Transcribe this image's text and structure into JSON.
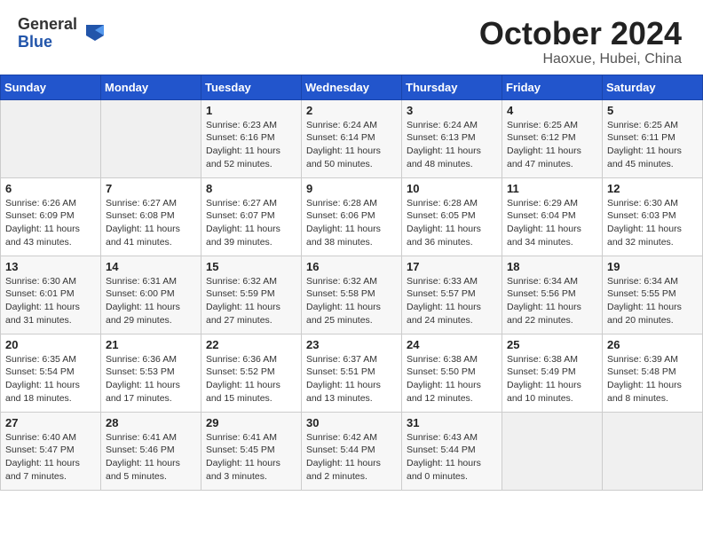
{
  "header": {
    "logo_general": "General",
    "logo_blue": "Blue",
    "month_title": "October 2024",
    "location": "Haoxue, Hubei, China"
  },
  "days_of_week": [
    "Sunday",
    "Monday",
    "Tuesday",
    "Wednesday",
    "Thursday",
    "Friday",
    "Saturday"
  ],
  "weeks": [
    [
      {
        "day": "",
        "info": ""
      },
      {
        "day": "",
        "info": ""
      },
      {
        "day": "1",
        "info": "Sunrise: 6:23 AM\nSunset: 6:16 PM\nDaylight: 11 hours and 52 minutes."
      },
      {
        "day": "2",
        "info": "Sunrise: 6:24 AM\nSunset: 6:14 PM\nDaylight: 11 hours and 50 minutes."
      },
      {
        "day": "3",
        "info": "Sunrise: 6:24 AM\nSunset: 6:13 PM\nDaylight: 11 hours and 48 minutes."
      },
      {
        "day": "4",
        "info": "Sunrise: 6:25 AM\nSunset: 6:12 PM\nDaylight: 11 hours and 47 minutes."
      },
      {
        "day": "5",
        "info": "Sunrise: 6:25 AM\nSunset: 6:11 PM\nDaylight: 11 hours and 45 minutes."
      }
    ],
    [
      {
        "day": "6",
        "info": "Sunrise: 6:26 AM\nSunset: 6:09 PM\nDaylight: 11 hours and 43 minutes."
      },
      {
        "day": "7",
        "info": "Sunrise: 6:27 AM\nSunset: 6:08 PM\nDaylight: 11 hours and 41 minutes."
      },
      {
        "day": "8",
        "info": "Sunrise: 6:27 AM\nSunset: 6:07 PM\nDaylight: 11 hours and 39 minutes."
      },
      {
        "day": "9",
        "info": "Sunrise: 6:28 AM\nSunset: 6:06 PM\nDaylight: 11 hours and 38 minutes."
      },
      {
        "day": "10",
        "info": "Sunrise: 6:28 AM\nSunset: 6:05 PM\nDaylight: 11 hours and 36 minutes."
      },
      {
        "day": "11",
        "info": "Sunrise: 6:29 AM\nSunset: 6:04 PM\nDaylight: 11 hours and 34 minutes."
      },
      {
        "day": "12",
        "info": "Sunrise: 6:30 AM\nSunset: 6:03 PM\nDaylight: 11 hours and 32 minutes."
      }
    ],
    [
      {
        "day": "13",
        "info": "Sunrise: 6:30 AM\nSunset: 6:01 PM\nDaylight: 11 hours and 31 minutes."
      },
      {
        "day": "14",
        "info": "Sunrise: 6:31 AM\nSunset: 6:00 PM\nDaylight: 11 hours and 29 minutes."
      },
      {
        "day": "15",
        "info": "Sunrise: 6:32 AM\nSunset: 5:59 PM\nDaylight: 11 hours and 27 minutes."
      },
      {
        "day": "16",
        "info": "Sunrise: 6:32 AM\nSunset: 5:58 PM\nDaylight: 11 hours and 25 minutes."
      },
      {
        "day": "17",
        "info": "Sunrise: 6:33 AM\nSunset: 5:57 PM\nDaylight: 11 hours and 24 minutes."
      },
      {
        "day": "18",
        "info": "Sunrise: 6:34 AM\nSunset: 5:56 PM\nDaylight: 11 hours and 22 minutes."
      },
      {
        "day": "19",
        "info": "Sunrise: 6:34 AM\nSunset: 5:55 PM\nDaylight: 11 hours and 20 minutes."
      }
    ],
    [
      {
        "day": "20",
        "info": "Sunrise: 6:35 AM\nSunset: 5:54 PM\nDaylight: 11 hours and 18 minutes."
      },
      {
        "day": "21",
        "info": "Sunrise: 6:36 AM\nSunset: 5:53 PM\nDaylight: 11 hours and 17 minutes."
      },
      {
        "day": "22",
        "info": "Sunrise: 6:36 AM\nSunset: 5:52 PM\nDaylight: 11 hours and 15 minutes."
      },
      {
        "day": "23",
        "info": "Sunrise: 6:37 AM\nSunset: 5:51 PM\nDaylight: 11 hours and 13 minutes."
      },
      {
        "day": "24",
        "info": "Sunrise: 6:38 AM\nSunset: 5:50 PM\nDaylight: 11 hours and 12 minutes."
      },
      {
        "day": "25",
        "info": "Sunrise: 6:38 AM\nSunset: 5:49 PM\nDaylight: 11 hours and 10 minutes."
      },
      {
        "day": "26",
        "info": "Sunrise: 6:39 AM\nSunset: 5:48 PM\nDaylight: 11 hours and 8 minutes."
      }
    ],
    [
      {
        "day": "27",
        "info": "Sunrise: 6:40 AM\nSunset: 5:47 PM\nDaylight: 11 hours and 7 minutes."
      },
      {
        "day": "28",
        "info": "Sunrise: 6:41 AM\nSunset: 5:46 PM\nDaylight: 11 hours and 5 minutes."
      },
      {
        "day": "29",
        "info": "Sunrise: 6:41 AM\nSunset: 5:45 PM\nDaylight: 11 hours and 3 minutes."
      },
      {
        "day": "30",
        "info": "Sunrise: 6:42 AM\nSunset: 5:44 PM\nDaylight: 11 hours and 2 minutes."
      },
      {
        "day": "31",
        "info": "Sunrise: 6:43 AM\nSunset: 5:44 PM\nDaylight: 11 hours and 0 minutes."
      },
      {
        "day": "",
        "info": ""
      },
      {
        "day": "",
        "info": ""
      }
    ]
  ]
}
